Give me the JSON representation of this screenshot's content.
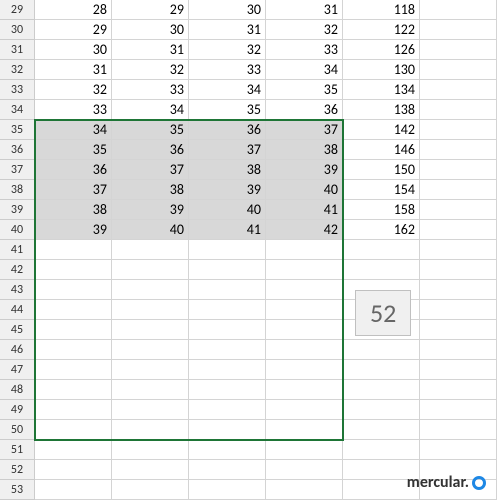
{
  "tooltip": "52",
  "watermark": "mercular.",
  "rows": [
    {
      "num": 29,
      "cells": [
        "28",
        "29",
        "30",
        "31",
        "118",
        ""
      ]
    },
    {
      "num": 30,
      "cells": [
        "29",
        "30",
        "31",
        "32",
        "122",
        ""
      ]
    },
    {
      "num": 31,
      "cells": [
        "30",
        "31",
        "32",
        "33",
        "126",
        ""
      ]
    },
    {
      "num": 32,
      "cells": [
        "31",
        "32",
        "33",
        "34",
        "130",
        ""
      ]
    },
    {
      "num": 33,
      "cells": [
        "32",
        "33",
        "34",
        "35",
        "134",
        ""
      ]
    },
    {
      "num": 34,
      "cells": [
        "33",
        "34",
        "35",
        "36",
        "138",
        ""
      ]
    },
    {
      "num": 35,
      "cells": [
        "34",
        "35",
        "36",
        "37",
        "142",
        ""
      ]
    },
    {
      "num": 36,
      "cells": [
        "35",
        "36",
        "37",
        "38",
        "146",
        ""
      ]
    },
    {
      "num": 37,
      "cells": [
        "36",
        "37",
        "38",
        "39",
        "150",
        ""
      ]
    },
    {
      "num": 38,
      "cells": [
        "37",
        "38",
        "39",
        "40",
        "154",
        ""
      ]
    },
    {
      "num": 39,
      "cells": [
        "38",
        "39",
        "40",
        "41",
        "158",
        ""
      ]
    },
    {
      "num": 40,
      "cells": [
        "39",
        "40",
        "41",
        "42",
        "162",
        ""
      ]
    },
    {
      "num": 41,
      "cells": [
        "",
        "",
        "",
        "",
        "",
        ""
      ]
    },
    {
      "num": 42,
      "cells": [
        "",
        "",
        "",
        "",
        "",
        ""
      ]
    },
    {
      "num": 43,
      "cells": [
        "",
        "",
        "",
        "",
        "",
        ""
      ]
    },
    {
      "num": 44,
      "cells": [
        "",
        "",
        "",
        "",
        "",
        ""
      ]
    },
    {
      "num": 45,
      "cells": [
        "",
        "",
        "",
        "",
        "",
        ""
      ]
    },
    {
      "num": 46,
      "cells": [
        "",
        "",
        "",
        "",
        "",
        ""
      ]
    },
    {
      "num": 47,
      "cells": [
        "",
        "",
        "",
        "",
        "",
        ""
      ]
    },
    {
      "num": 48,
      "cells": [
        "",
        "",
        "",
        "",
        "",
        ""
      ]
    },
    {
      "num": 49,
      "cells": [
        "",
        "",
        "",
        "",
        "",
        ""
      ]
    },
    {
      "num": 50,
      "cells": [
        "",
        "",
        "",
        "",
        "",
        ""
      ]
    },
    {
      "num": 51,
      "cells": [
        "",
        "",
        "",
        "",
        "",
        ""
      ]
    },
    {
      "num": 52,
      "cells": [
        "",
        "",
        "",
        "",
        "",
        ""
      ]
    },
    {
      "num": 53,
      "cells": [
        "",
        "",
        "",
        "",
        "",
        ""
      ]
    }
  ],
  "selection": {
    "startRow": 35,
    "endRow": 50,
    "startCol": 0,
    "endCol": 3,
    "filledEndRow": 40
  }
}
